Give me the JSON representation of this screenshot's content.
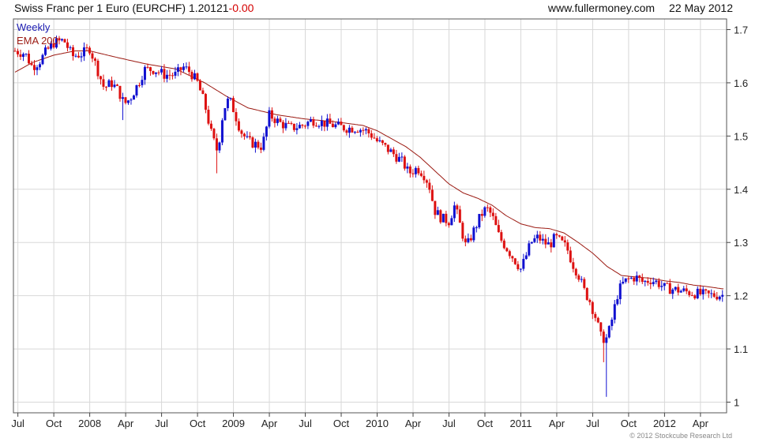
{
  "header": {
    "title": "Swiss Franc per 1 Euro (EURCHF)",
    "last": "1.20121",
    "change": "-0.00",
    "site": "www.fullermoney.com",
    "date": "22 May 2012"
  },
  "copyright": "© 2012 Stockcube Research Ltd",
  "colors": {
    "up": "#1010d0",
    "down": "#dd1010",
    "ema": "#9b1a12",
    "axis": "#444444",
    "grid": "#d8d8d8"
  },
  "chart_data": {
    "type": "candlestick",
    "interval_label": "Weekly",
    "indicator_label": "EMA 200",
    "ylim": [
      0.98,
      1.72
    ],
    "yticks": [
      1,
      1.1,
      1.2,
      1.3,
      1.4,
      1.5,
      1.6,
      1.7
    ],
    "x_range": [
      2007.48,
      2012.41
    ],
    "xticks": [
      {
        "label": "Jul",
        "t": 2007.5
      },
      {
        "label": "Oct",
        "t": 2007.75
      },
      {
        "label": "2008",
        "t": 2008.0
      },
      {
        "label": "Apr",
        "t": 2008.25
      },
      {
        "label": "Jul",
        "t": 2008.5
      },
      {
        "label": "Oct",
        "t": 2008.75
      },
      {
        "label": "2009",
        "t": 2009.0
      },
      {
        "label": "Apr",
        "t": 2009.25
      },
      {
        "label": "Jul",
        "t": 2009.5
      },
      {
        "label": "Oct",
        "t": 2009.75
      },
      {
        "label": "2010",
        "t": 2010.0
      },
      {
        "label": "Apr",
        "t": 2010.25
      },
      {
        "label": "Jul",
        "t": 2010.5
      },
      {
        "label": "Oct",
        "t": 2010.75
      },
      {
        "label": "2011",
        "t": 2011.0
      },
      {
        "label": "Apr",
        "t": 2011.25
      },
      {
        "label": "Jul",
        "t": 2011.5
      },
      {
        "label": "Oct",
        "t": 2011.75
      },
      {
        "label": "2012",
        "t": 2012.0
      },
      {
        "label": "Apr",
        "t": 2012.25
      }
    ],
    "close_anchors": [
      [
        2007.48,
        1.66
      ],
      [
        2007.55,
        1.655
      ],
      [
        2007.6,
        1.63
      ],
      [
        2007.65,
        1.64
      ],
      [
        2007.7,
        1.66
      ],
      [
        2007.75,
        1.675
      ],
      [
        2007.82,
        1.68
      ],
      [
        2007.88,
        1.65
      ],
      [
        2007.95,
        1.655
      ],
      [
        2008.0,
        1.665
      ],
      [
        2008.06,
        1.62
      ],
      [
        2008.1,
        1.59
      ],
      [
        2008.15,
        1.6
      ],
      [
        2008.2,
        1.585
      ],
      [
        2008.24,
        1.56
      ],
      [
        2008.28,
        1.57
      ],
      [
        2008.34,
        1.6
      ],
      [
        2008.38,
        1.625
      ],
      [
        2008.45,
        1.625
      ],
      [
        2008.52,
        1.615
      ],
      [
        2008.6,
        1.615
      ],
      [
        2008.65,
        1.63
      ],
      [
        2008.7,
        1.62
      ],
      [
        2008.75,
        1.6
      ],
      [
        2008.8,
        1.56
      ],
      [
        2008.85,
        1.5
      ],
      [
        2008.89,
        1.47
      ],
      [
        2008.93,
        1.55
      ],
      [
        2008.97,
        1.57
      ],
      [
        2009.0,
        1.55
      ],
      [
        2009.05,
        1.51
      ],
      [
        2009.1,
        1.49
      ],
      [
        2009.15,
        1.485
      ],
      [
        2009.2,
        1.48
      ],
      [
        2009.25,
        1.54
      ],
      [
        2009.32,
        1.525
      ],
      [
        2009.4,
        1.515
      ],
      [
        2009.48,
        1.52
      ],
      [
        2009.55,
        1.53
      ],
      [
        2009.62,
        1.525
      ],
      [
        2009.7,
        1.52
      ],
      [
        2009.78,
        1.515
      ],
      [
        2009.86,
        1.515
      ],
      [
        2009.92,
        1.51
      ],
      [
        2009.97,
        1.5
      ],
      [
        2010.0,
        1.49
      ],
      [
        2010.05,
        1.48
      ],
      [
        2010.12,
        1.465
      ],
      [
        2010.18,
        1.45
      ],
      [
        2010.22,
        1.43
      ],
      [
        2010.28,
        1.44
      ],
      [
        2010.32,
        1.43
      ],
      [
        2010.36,
        1.41
      ],
      [
        2010.4,
        1.36
      ],
      [
        2010.45,
        1.345
      ],
      [
        2010.5,
        1.34
      ],
      [
        2010.54,
        1.37
      ],
      [
        2010.58,
        1.33
      ],
      [
        2010.62,
        1.29
      ],
      [
        2010.66,
        1.315
      ],
      [
        2010.72,
        1.35
      ],
      [
        2010.76,
        1.365
      ],
      [
        2010.8,
        1.35
      ],
      [
        2010.85,
        1.31
      ],
      [
        2010.9,
        1.29
      ],
      [
        2010.95,
        1.27
      ],
      [
        2011.0,
        1.25
      ],
      [
        2011.03,
        1.27
      ],
      [
        2011.07,
        1.3
      ],
      [
        2011.12,
        1.31
      ],
      [
        2011.16,
        1.3
      ],
      [
        2011.2,
        1.295
      ],
      [
        2011.24,
        1.31
      ],
      [
        2011.28,
        1.3
      ],
      [
        2011.32,
        1.29
      ],
      [
        2011.36,
        1.26
      ],
      [
        2011.4,
        1.24
      ],
      [
        2011.44,
        1.21
      ],
      [
        2011.48,
        1.19
      ],
      [
        2011.52,
        1.16
      ],
      [
        2011.56,
        1.12
      ],
      [
        2011.6,
        1.12
      ],
      [
        2011.63,
        1.15
      ],
      [
        2011.67,
        1.2
      ],
      [
        2011.7,
        1.22
      ],
      [
        2011.74,
        1.23
      ],
      [
        2011.8,
        1.235
      ],
      [
        2011.85,
        1.225
      ],
      [
        2011.9,
        1.23
      ],
      [
        2011.95,
        1.225
      ],
      [
        2012.0,
        1.215
      ],
      [
        2012.1,
        1.21
      ],
      [
        2012.2,
        1.205
      ],
      [
        2012.3,
        1.201
      ],
      [
        2012.39,
        1.2012
      ]
    ],
    "ema_anchors": [
      [
        2007.48,
        1.62
      ],
      [
        2007.6,
        1.638
      ],
      [
        2007.75,
        1.652
      ],
      [
        2007.9,
        1.66
      ],
      [
        2008.0,
        1.66
      ],
      [
        2008.2,
        1.647
      ],
      [
        2008.4,
        1.635
      ],
      [
        2008.6,
        1.626
      ],
      [
        2008.8,
        1.6
      ],
      [
        2008.95,
        1.575
      ],
      [
        2009.1,
        1.553
      ],
      [
        2009.3,
        1.54
      ],
      [
        2009.5,
        1.532
      ],
      [
        2009.7,
        1.527
      ],
      [
        2009.9,
        1.52
      ],
      [
        2010.0,
        1.51
      ],
      [
        2010.1,
        1.495
      ],
      [
        2010.2,
        1.48
      ],
      [
        2010.3,
        1.46
      ],
      [
        2010.4,
        1.435
      ],
      [
        2010.5,
        1.41
      ],
      [
        2010.6,
        1.393
      ],
      [
        2010.7,
        1.383
      ],
      [
        2010.8,
        1.37
      ],
      [
        2010.9,
        1.35
      ],
      [
        2011.0,
        1.335
      ],
      [
        2011.1,
        1.328
      ],
      [
        2011.2,
        1.326
      ],
      [
        2011.3,
        1.318
      ],
      [
        2011.4,
        1.3
      ],
      [
        2011.5,
        1.28
      ],
      [
        2011.6,
        1.255
      ],
      [
        2011.7,
        1.238
      ],
      [
        2011.8,
        1.235
      ],
      [
        2011.9,
        1.233
      ],
      [
        2012.0,
        1.228
      ],
      [
        2012.1,
        1.225
      ],
      [
        2012.2,
        1.22
      ],
      [
        2012.3,
        1.217
      ],
      [
        2012.4,
        1.213
      ]
    ],
    "spikes": [
      {
        "t": 2008.23,
        "low": 1.53
      },
      {
        "t": 2008.88,
        "low": 1.43
      },
      {
        "t": 2011.58,
        "low": 1.075
      },
      {
        "t": 2011.6,
        "low": 1.01
      }
    ]
  }
}
